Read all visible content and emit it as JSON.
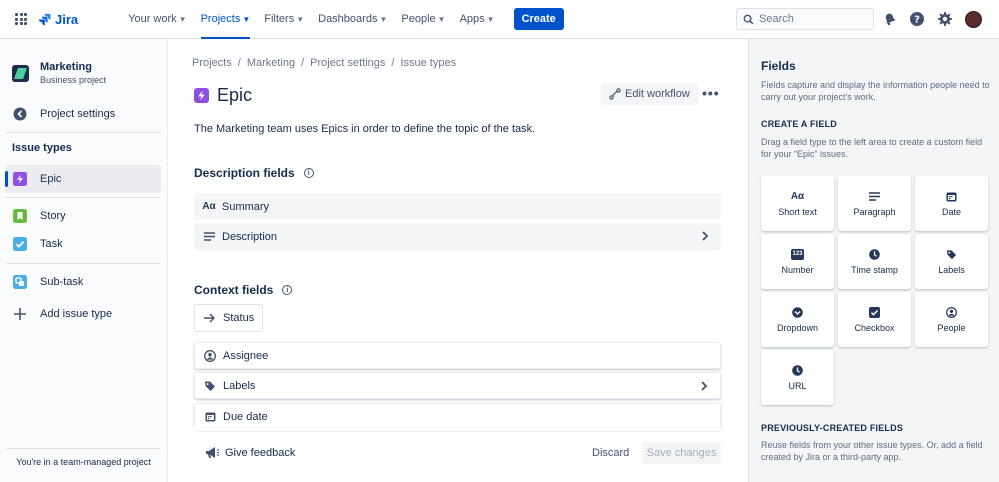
{
  "topbar": {
    "logo": "Jira",
    "nav": [
      {
        "label": "Your work"
      },
      {
        "label": "Projects"
      },
      {
        "label": "Filters"
      },
      {
        "label": "Dashboards"
      },
      {
        "label": "People"
      },
      {
        "label": "Apps"
      }
    ],
    "create_label": "Create",
    "search_placeholder": "Search"
  },
  "sidebar": {
    "project_name": "Marketing",
    "project_type": "Business project",
    "project_settings": "Project settings",
    "issue_types_heading": "Issue types",
    "items": [
      {
        "label": "Epic",
        "icon": "epic-icon",
        "color": "#904ee2"
      },
      {
        "label": "Story",
        "icon": "story-icon",
        "color": "#63ba3c"
      },
      {
        "label": "Task",
        "icon": "task-icon",
        "color": "#4bade8"
      },
      {
        "label": "Sub-task",
        "icon": "subtask-icon",
        "color": "#4bade8"
      },
      {
        "label": "Add issue type",
        "icon": "plus-icon"
      }
    ],
    "footer": "You're in a team-managed project"
  },
  "main": {
    "breadcrumbs": [
      "Projects",
      "Marketing",
      "Project settings",
      "Issue types"
    ],
    "title": "Epic",
    "edit_workflow": "Edit workflow",
    "description": "The Marketing team uses Epics in order to define the topic of the task.",
    "description_fields_heading": "Description fields",
    "description_fields": [
      {
        "label": "Summary",
        "icon": "text-icon"
      },
      {
        "label": "Description",
        "icon": "paragraph-icon"
      }
    ],
    "context_fields_heading": "Context fields",
    "status": "Status",
    "context_fields": [
      {
        "label": "Assignee",
        "icon": "person-icon"
      },
      {
        "label": "Labels",
        "icon": "label-icon"
      },
      {
        "label": "Due date",
        "icon": "calendar-icon"
      }
    ],
    "give_feedback": "Give feedback",
    "discard": "Discard",
    "save_changes": "Save changes"
  },
  "panel": {
    "title": "Fields",
    "intro": "Fields capture and display the information people need to carry out your project's work.",
    "create_heading": "CREATE A FIELD",
    "create_text": "Drag a field type to the left area to create a custom field for your “Epic” issues.",
    "tiles": [
      {
        "label": "Short text",
        "icon": "text-icon"
      },
      {
        "label": "Paragraph",
        "icon": "paragraph-icon"
      },
      {
        "label": "Date",
        "icon": "calendar-icon"
      },
      {
        "label": "Number",
        "icon": "number-icon"
      },
      {
        "label": "Time stamp",
        "icon": "clock-icon"
      },
      {
        "label": "Labels",
        "icon": "label-icon"
      },
      {
        "label": "Dropdown",
        "icon": "dropdown-icon"
      },
      {
        "label": "Checkbox",
        "icon": "checkbox-icon"
      },
      {
        "label": "People",
        "icon": "person-icon"
      },
      {
        "label": "URL",
        "icon": "clock-icon"
      }
    ],
    "previous_heading": "PREVIOUSLY-CREATED FIELDS",
    "previous_text": "Reuse fields from your other issue types. Or, add a field created by Jira or a third-party app."
  },
  "icon_texts": {
    "text_glyph": "Aα",
    "number_glyph": "123"
  }
}
